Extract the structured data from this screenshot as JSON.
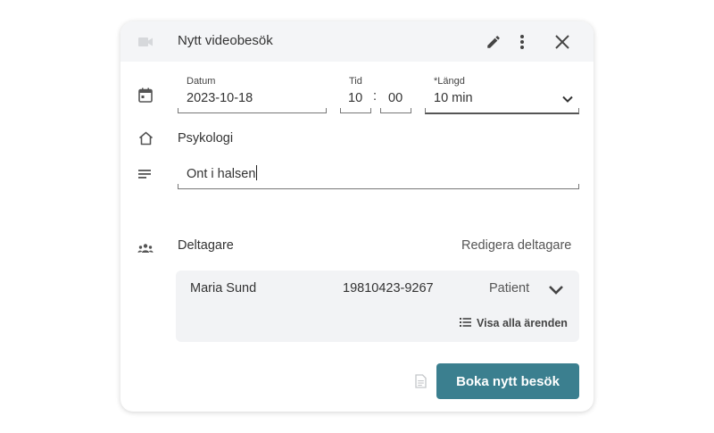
{
  "header": {
    "title": "Nytt videobesök",
    "icons": [
      "video-icon",
      "edit-pencil-icon",
      "more-vert-icon",
      "close-icon"
    ]
  },
  "form": {
    "date": {
      "label": "Datum",
      "value": "2023-10-18"
    },
    "time": {
      "label": "Tid",
      "hour": "10",
      "separator": ":",
      "minute": "00"
    },
    "length": {
      "label": "*Längd",
      "value": "10 min"
    },
    "unit": "Psykologi",
    "reason": "Ont i halsen"
  },
  "participants": {
    "label": "Deltagare",
    "edit_link": "Redigera deltagare",
    "list": [
      {
        "name": "Maria Sund",
        "id": "19810423-9267",
        "role": "Patient"
      }
    ],
    "show_all": "Visa alla ärenden"
  },
  "footer": {
    "book_button": "Boka nytt besök"
  },
  "colors": {
    "accent": "#3b7f8f",
    "header_bg": "#f4f5f7",
    "participant_bg": "#f2f3f5"
  }
}
